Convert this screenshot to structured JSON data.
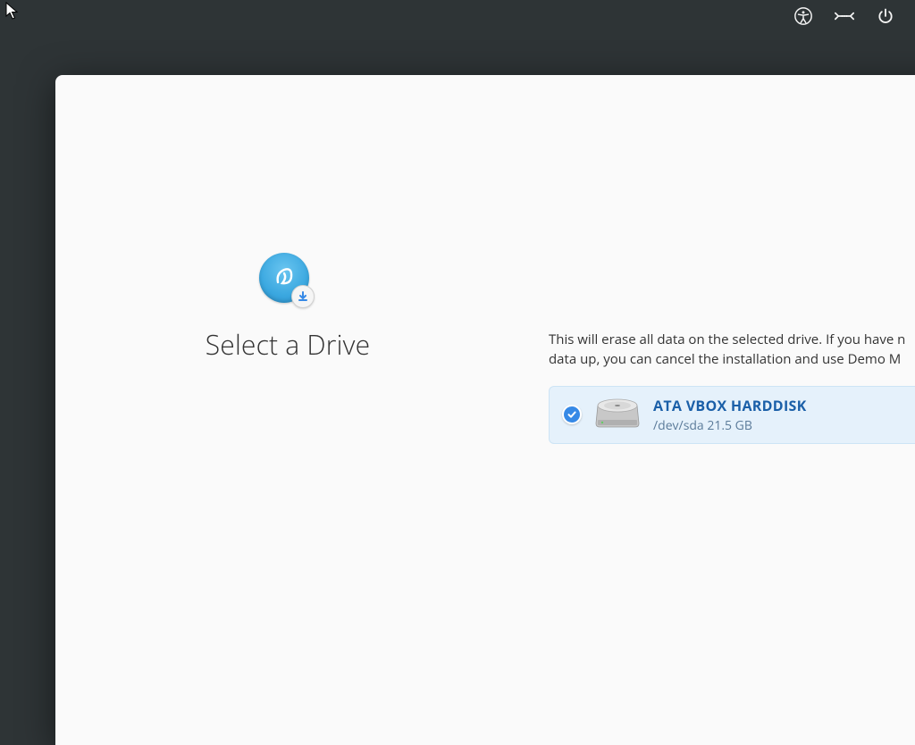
{
  "topbar": {
    "icons": [
      "accessibility-icon",
      "network-icon",
      "power-icon"
    ]
  },
  "installer": {
    "page_title": "Select a Drive",
    "warning_line1": "This will erase all data on the selected drive. If you have n",
    "warning_line2": "data up, you can cancel the installation and use Demo M",
    "drives": [
      {
        "name": "ATA VBOX HARDDISK",
        "path": "/dev/sda 21.5 GB",
        "selected": true
      }
    ]
  }
}
